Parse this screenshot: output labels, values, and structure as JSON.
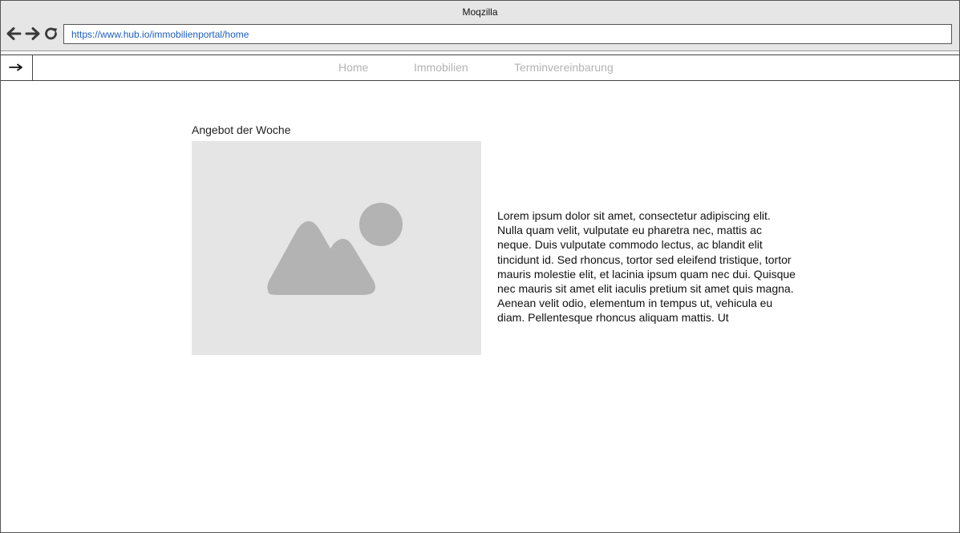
{
  "browser": {
    "title": "Moqzilla",
    "url": "https://www.hub.io/immobilienportal/home",
    "icons": {
      "back": "arrow-left-icon",
      "forward": "arrow-right-icon",
      "reload": "reload-icon"
    }
  },
  "navbar": {
    "toggle_icon": "arrow-right-icon",
    "links": [
      {
        "label": "Home"
      },
      {
        "label": "Immobilien"
      },
      {
        "label": "Terminvereinbarung"
      }
    ],
    "link_color": "#b3b3b3"
  },
  "main": {
    "offer_heading": "Angebot der Woche",
    "image_icon": "image-placeholder-icon",
    "description": "Lorem ipsum dolor sit amet, consectetur adipiscing elit. Nulla quam velit, vulputate eu pharetra nec, mattis ac neque. Duis vulputate commodo lectus, ac blandit elit tincidunt id. Sed rhoncus, tortor sed eleifend tristique, tortor mauris molestie elit, et lacinia ipsum quam nec dui. Quisque nec mauris sit amet elit iaculis pretium sit amet quis magna. Aenean velit odio, elementum in tempus ut, vehicula eu diam. Pellentesque rhoncus aliquam mattis. Ut"
  }
}
